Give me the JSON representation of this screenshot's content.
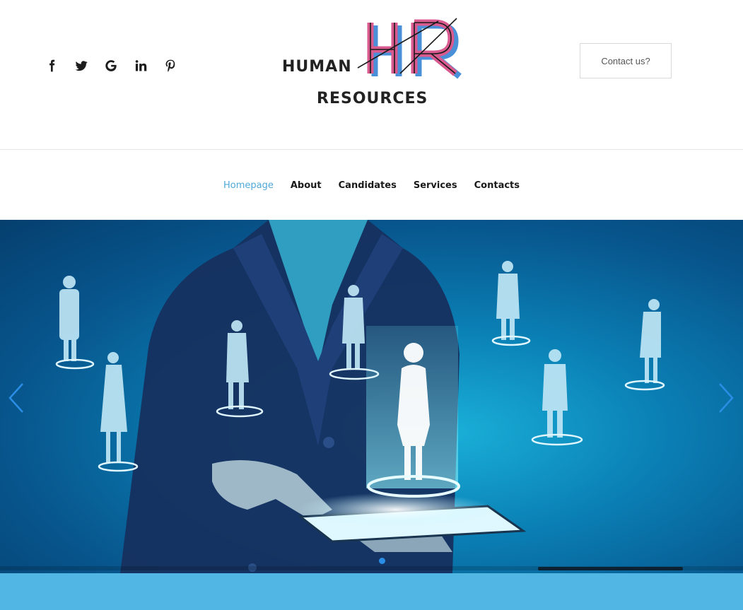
{
  "header": {
    "social_icons": [
      {
        "name": "facebook-icon",
        "glyph": "f"
      },
      {
        "name": "twitter-icon",
        "glyph": "twitter"
      },
      {
        "name": "google-icon",
        "glyph": "G"
      },
      {
        "name": "linkedin-icon",
        "glyph": "in"
      },
      {
        "name": "pinterest-icon",
        "glyph": "pinterest"
      }
    ],
    "logo": {
      "word_top": "HUMAN",
      "word_bottom": "RESOURCES",
      "mark": "HR",
      "mark_colors": [
        "#d85a8f",
        "#4a90d9",
        "#1a1a1a"
      ]
    },
    "contact_label": "Contact us?"
  },
  "nav": {
    "items": [
      {
        "label": "Homepage",
        "active": true
      },
      {
        "label": "About",
        "active": false
      },
      {
        "label": "Candidates",
        "active": false
      },
      {
        "label": "Services",
        "active": false
      },
      {
        "label": "Contacts",
        "active": false
      }
    ],
    "active_color": "#4fa8d8"
  },
  "slider": {
    "prev_icon": "chevron-left-icon",
    "next_icon": "chevron-right-icon",
    "arrow_color": "#2a8ee6",
    "current_slide": 1,
    "slide_count": 1,
    "progress": 0.2
  },
  "colors": {
    "band": "#52b6e4",
    "hero_base": "#0a7fb4"
  }
}
